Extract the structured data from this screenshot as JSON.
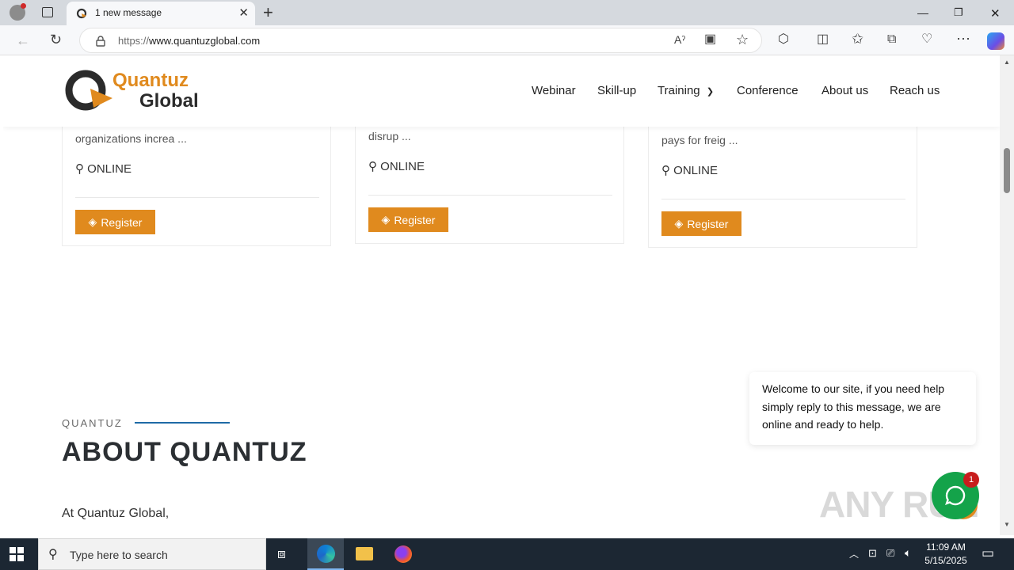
{
  "browser": {
    "tab_title": "1 new message",
    "url_scheme": "https://",
    "url_host": "www.quantuzglobal.com"
  },
  "site": {
    "logo_line1": "Quantuz",
    "logo_line2": "Global",
    "nav": [
      "Webinar",
      "Skill-up",
      "Training",
      "Conference",
      "About us",
      "Reach us"
    ]
  },
  "cards": [
    {
      "text": "organizations increa ...",
      "location": "ONLINE",
      "button": "Register"
    },
    {
      "text": "disrup ...",
      "location": "ONLINE",
      "button": "Register"
    },
    {
      "text": "pays for freig ...",
      "location": "ONLINE",
      "button": "Register"
    }
  ],
  "about": {
    "kicker": "QUANTUZ",
    "title": "ABOUT QUANTUZ",
    "intro": "At Quantuz Global,"
  },
  "chat": {
    "message": "Welcome to our site, if you need help simply reply to this message, we are online and ready to help.",
    "badge": "1"
  },
  "watermark": "ANY RUN",
  "taskbar": {
    "search_placeholder": "Type here to search",
    "time": "11:09 AM",
    "date": "5/15/2025"
  },
  "colors": {
    "brand_orange": "#e08a1e",
    "accent_blue": "#1e6aa6",
    "chat_green": "#14a34a"
  }
}
